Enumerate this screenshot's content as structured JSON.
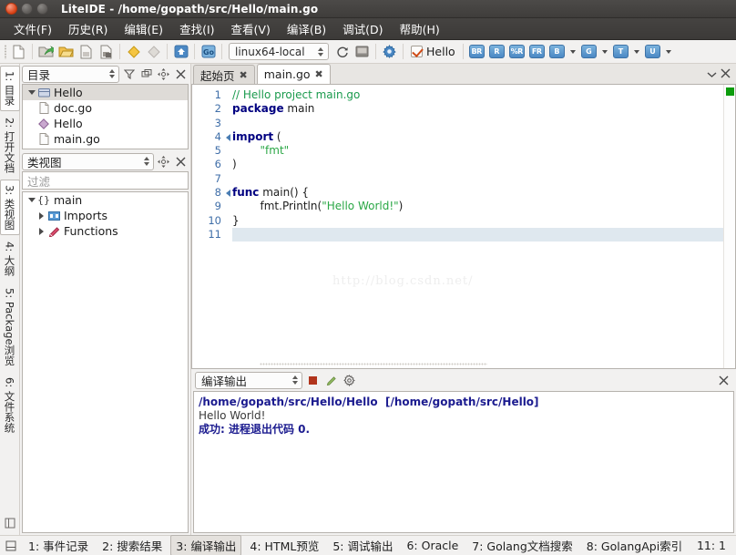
{
  "window": {
    "title": "LiteIDE - /home/gopath/src/Hello/main.go",
    "buttons": {
      "close": "close-button",
      "minimize": "minimize-button",
      "maximize": "maximize-button"
    }
  },
  "menubar": {
    "items": [
      {
        "label": "文件(F)"
      },
      {
        "label": "历史(R)"
      },
      {
        "label": "编辑(E)"
      },
      {
        "label": "查找(I)"
      },
      {
        "label": "查看(V)"
      },
      {
        "label": "编译(B)"
      },
      {
        "label": "调试(D)"
      },
      {
        "label": "帮助(H)"
      }
    ]
  },
  "toolbar": {
    "env_selector": "linux64-local",
    "target_checkbox_label": "Hello",
    "icons": [
      "new-file-icon",
      "open-folder-icon",
      "open-file-icon",
      "save-icon",
      "save-all-icon",
      "build-icon",
      "build-stop-icon",
      "home-icon",
      "go-icon",
      "reload-icon",
      "terminal-icon",
      "settings-icon"
    ],
    "badges": [
      "BR",
      "R",
      "%R",
      "FR",
      "B",
      "G",
      "T",
      "U"
    ]
  },
  "sidebar": {
    "tabs": [
      {
        "label": "1: 目录",
        "active": true
      },
      {
        "label": "2: 打开文档",
        "active": false
      },
      {
        "label": "3: 类视图",
        "active": true
      },
      {
        "label": "4: 大纲",
        "active": false
      },
      {
        "label": "5: Package浏览",
        "active": false
      },
      {
        "label": "6: 文件系统",
        "active": false
      }
    ]
  },
  "folders_panel": {
    "title": "目录",
    "header_icons": [
      "filter-icon",
      "sync-icon",
      "locate-icon",
      "close-icon"
    ],
    "tree": [
      {
        "label": "Hello",
        "icon": "folder-icon",
        "level": 0,
        "expanded": true,
        "selected": true
      },
      {
        "label": "doc.go",
        "icon": "file-icon",
        "level": 1,
        "selected": false
      },
      {
        "label": "Hello",
        "icon": "binary-icon",
        "level": 1,
        "selected": false
      },
      {
        "label": "main.go",
        "icon": "file-icon",
        "level": 1,
        "selected": false
      }
    ]
  },
  "classview_panel": {
    "title": "类视图",
    "header_icons": [
      "locate-icon",
      "close-icon"
    ],
    "filter_placeholder": "过滤",
    "filter_value": "",
    "tree": [
      {
        "label": "main",
        "icon": "package-icon",
        "level": 0,
        "expanded": true
      },
      {
        "label": "Imports",
        "icon": "imports-icon",
        "level": 1,
        "expanded": false
      },
      {
        "label": "Functions",
        "icon": "functions-icon",
        "level": 1,
        "expanded": false
      }
    ]
  },
  "editor": {
    "tabs": [
      {
        "label": "起始页",
        "active": false
      },
      {
        "label": "main.go",
        "active": true
      }
    ],
    "watermark": "http://blog.csdn.net/",
    "line_numbers": [
      "1",
      "2",
      "3",
      "4",
      "5",
      "6",
      "7",
      "8",
      "9",
      "10",
      "11"
    ],
    "fold_lines": [
      4,
      8
    ],
    "current_line": 11,
    "code": [
      {
        "n": 1,
        "tokens": [
          {
            "t": "// Hello project main.go",
            "c": "cmt"
          }
        ]
      },
      {
        "n": 2,
        "tokens": [
          {
            "t": "package",
            "c": "kw"
          },
          {
            "t": " main",
            "c": "plain"
          }
        ]
      },
      {
        "n": 3,
        "tokens": [
          {
            "t": "",
            "c": "plain"
          }
        ]
      },
      {
        "n": 4,
        "tokens": [
          {
            "t": "import",
            "c": "kw"
          },
          {
            "t": " (",
            "c": "plain"
          }
        ]
      },
      {
        "n": 5,
        "tokens": [
          {
            "t": "        ",
            "c": "plain"
          },
          {
            "t": "\"fmt\"",
            "c": "str"
          }
        ]
      },
      {
        "n": 6,
        "tokens": [
          {
            "t": ")",
            "c": "plain"
          }
        ]
      },
      {
        "n": 7,
        "tokens": [
          {
            "t": "",
            "c": "plain"
          }
        ]
      },
      {
        "n": 8,
        "tokens": [
          {
            "t": "func",
            "c": "kw"
          },
          {
            "t": " main() {",
            "c": "plain"
          }
        ]
      },
      {
        "n": 9,
        "tokens": [
          {
            "t": "        fmt.Println(",
            "c": "plain"
          },
          {
            "t": "\"Hello World!\"",
            "c": "str"
          },
          {
            "t": ")",
            "c": "plain"
          }
        ]
      },
      {
        "n": 10,
        "tokens": [
          {
            "t": "}",
            "c": "plain"
          }
        ]
      },
      {
        "n": 11,
        "tokens": [
          {
            "t": "",
            "c": "plain"
          }
        ]
      }
    ]
  },
  "output_panel": {
    "title": "编译输出",
    "icons": [
      "stop-icon",
      "clear-icon",
      "settings-icon",
      "close-icon"
    ],
    "lines": [
      {
        "text": "/home/gopath/src/Hello/Hello  [/home/gopath/src/Hello]",
        "style": "link"
      },
      {
        "text": "Hello World!",
        "style": "normal"
      },
      {
        "text": "成功: 进程退出代码 0.",
        "style": "ok"
      }
    ]
  },
  "statusbar": {
    "items": [
      {
        "label": "1: 事件记录",
        "active": false
      },
      {
        "label": "2: 搜索结果",
        "active": false
      },
      {
        "label": "3: 编译输出",
        "active": true
      },
      {
        "label": "4: HTML预览",
        "active": false
      },
      {
        "label": "5: 调试输出",
        "active": false
      },
      {
        "label": "6: Oracle",
        "active": false
      },
      {
        "label": "7: Golang文档搜索",
        "active": false
      },
      {
        "label": "8: GolangApi索引",
        "active": false
      }
    ],
    "cursor_position": "11: 1"
  },
  "colors": {
    "titlebar": "#3f3d3b",
    "keyword": "#000080",
    "comment": "#1a9a4d",
    "string": "#2aa745",
    "output_link": "#1b1b8f",
    "marker_green": "#0c9c0c",
    "accent_blue": "#4b88c4"
  }
}
